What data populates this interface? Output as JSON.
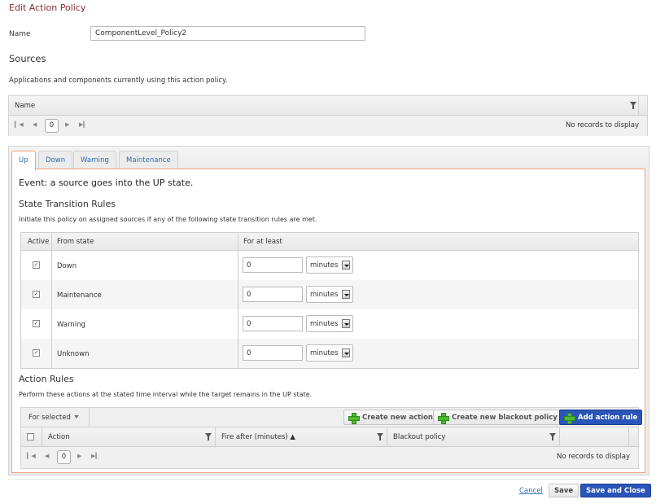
{
  "page": {
    "title": "Edit Action Policy",
    "name_label": "Name",
    "name_value": "ComponentLevel_Policy2"
  },
  "sources": {
    "title": "Sources",
    "description": "Applications and components currently using this action policy.",
    "grid": {
      "columns": [
        "Name"
      ],
      "page": "0",
      "empty_text": "No records to display"
    }
  },
  "tabs": [
    {
      "label": "Up",
      "active": true
    },
    {
      "label": "Down",
      "active": false
    },
    {
      "label": "Warning",
      "active": false
    },
    {
      "label": "Maintenance",
      "active": false
    }
  ],
  "up_tab": {
    "event_text": "Event: a source goes into the UP state.",
    "state_transition": {
      "title": "State Transition Rules",
      "description": "Initiate this policy on assigned sources if any of the following state transition rules are met.",
      "columns": [
        "Active",
        "From state",
        "For at least"
      ],
      "rows": [
        {
          "active": true,
          "state": "Down",
          "value": "0",
          "unit": "minutes"
        },
        {
          "active": true,
          "state": "Maintenance",
          "value": "0",
          "unit": "minutes"
        },
        {
          "active": true,
          "state": "Warning",
          "value": "0",
          "unit": "minutes"
        },
        {
          "active": true,
          "state": "Unknown",
          "value": "0",
          "unit": "minutes"
        }
      ]
    },
    "action_rules": {
      "title": "Action Rules",
      "description": "Perform these actions at the stated time interval while the target remains in the UP state.",
      "toolbar": {
        "for_selected": "For selected",
        "create_action": "Create new action",
        "create_blackout": "Create new blackout policy",
        "add_rule": "Add action rule"
      },
      "columns": [
        "Action",
        "Fire after (minutes) ▲",
        "Blackout policy"
      ],
      "page": "0",
      "empty_text": "No records to display"
    }
  },
  "footer": {
    "cancel": "Cancel",
    "save": "Save",
    "save_close": "Save and Close"
  },
  "colors": {
    "title": "#8b2a2a",
    "link": "#2f6db5",
    "primary": "#2a55b8",
    "tab_active_border": "#f0a27a",
    "plus_icon": "#4fb830"
  }
}
